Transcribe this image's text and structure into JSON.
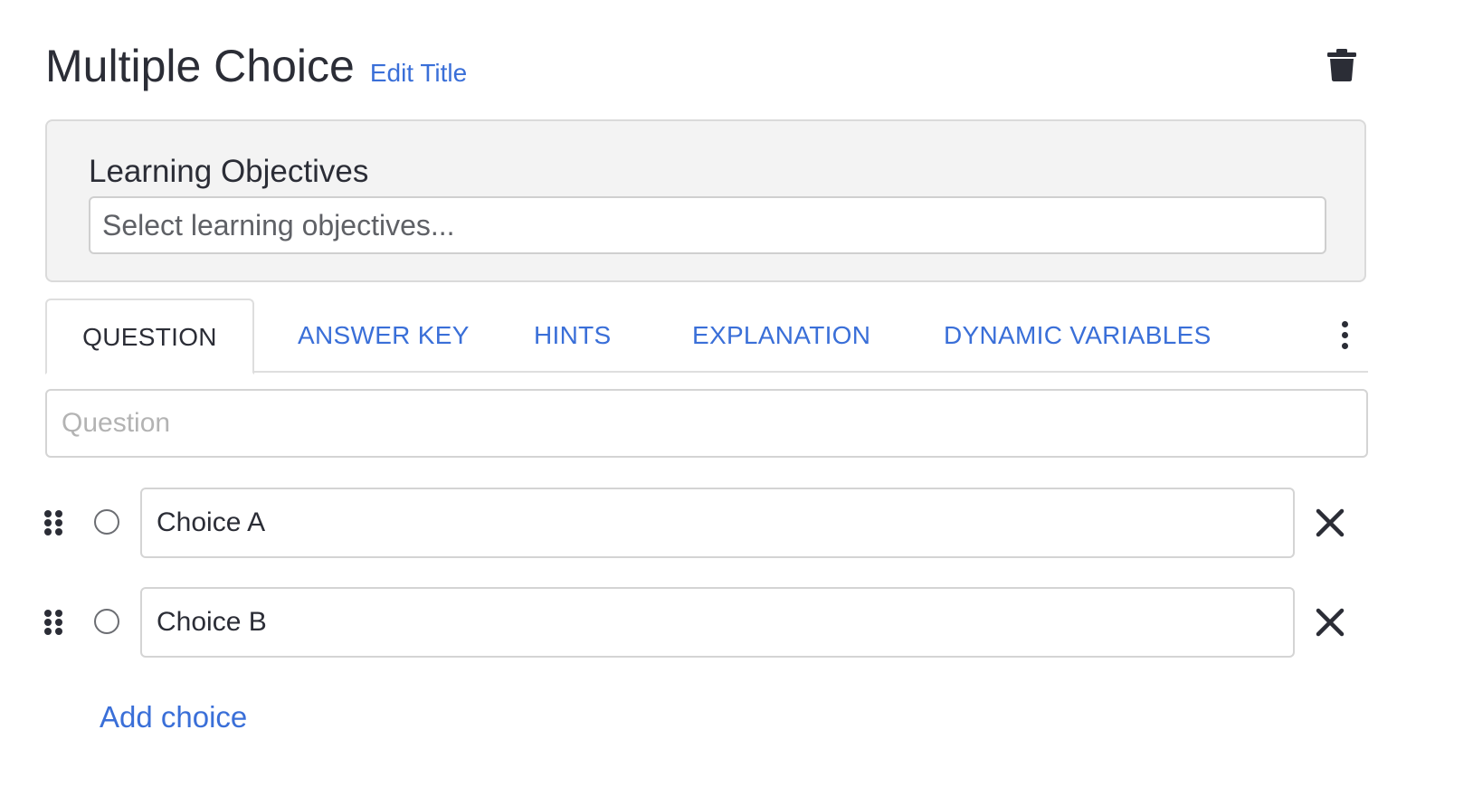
{
  "header": {
    "title": "Multiple Choice",
    "edit_title_label": "Edit Title",
    "delete_icon": "trash-icon"
  },
  "learning_objectives": {
    "label": "Learning Objectives",
    "placeholder": "Select learning objectives..."
  },
  "tabs": [
    {
      "label": "QUESTION",
      "active": true
    },
    {
      "label": "ANSWER KEY",
      "active": false
    },
    {
      "label": "HINTS",
      "active": false
    },
    {
      "label": "EXPLANATION",
      "active": false
    },
    {
      "label": "DYNAMIC VARIABLES",
      "active": false
    }
  ],
  "more_icon": "vertical-ellipsis-icon",
  "question": {
    "placeholder": "Question",
    "value": ""
  },
  "choices": [
    {
      "value": "Choice A",
      "selected": false
    },
    {
      "value": "Choice B",
      "selected": false
    }
  ],
  "add_choice_label": "Add choice",
  "colors": {
    "link": "#3a6fd8",
    "text": "#2b2d36",
    "panel_bg": "#f3f3f3",
    "border": "#d4d4d4"
  }
}
